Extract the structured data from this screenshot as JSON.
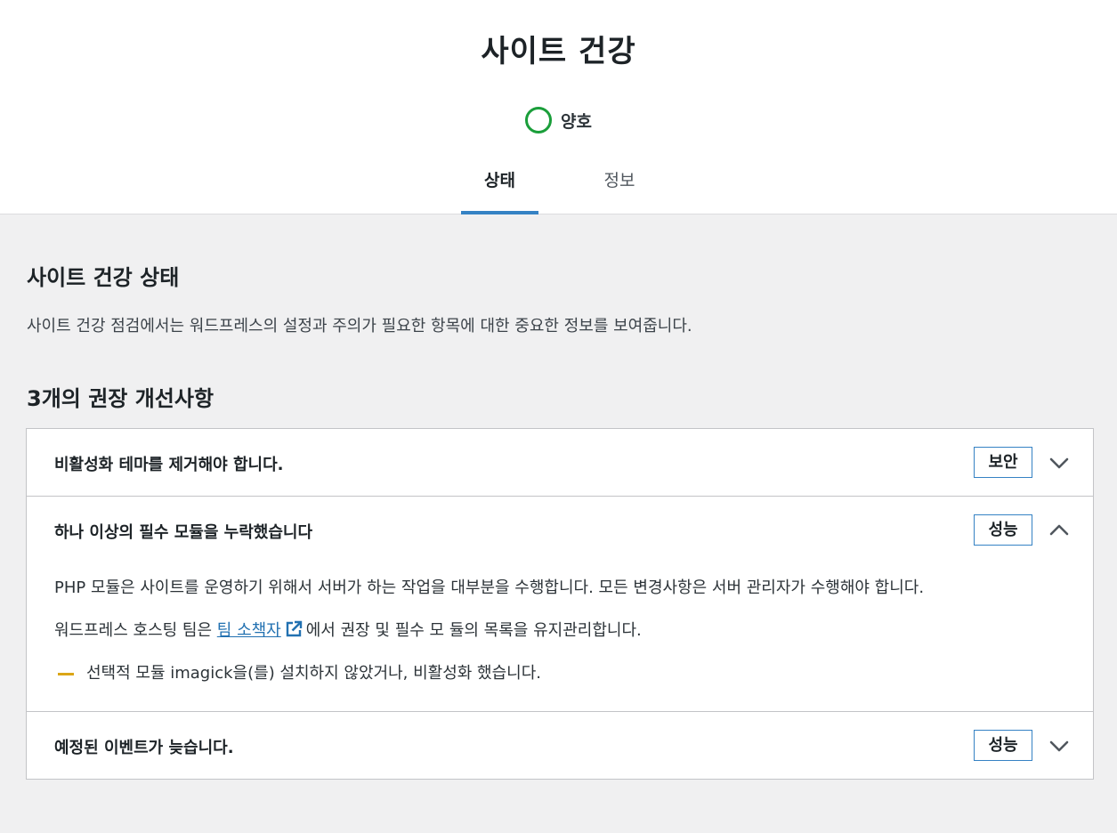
{
  "header": {
    "title": "사이트 건강",
    "status_label": "양호",
    "status_color": "#1a9e3a",
    "tabs": [
      {
        "label": "상태",
        "active": true
      },
      {
        "label": "정보",
        "active": false
      }
    ]
  },
  "main": {
    "section_title": "사이트 건강 상태",
    "section_description": "사이트 건강 점검에서는 워드프레스의 설정과 주의가 필요한 항목에 대한 중요한 정보를 보여줍니다.",
    "recommendations_count": "3개의 권장 개선사항",
    "items": [
      {
        "title": "비활성화 테마를 제거해야 합니다.",
        "badge": "보안",
        "expanded": false,
        "chevron": "chevron-down-icon"
      },
      {
        "title": "하나 이상의 필수 모듈을 누락했습니다",
        "badge": "성능",
        "expanded": true,
        "chevron": "chevron-up-icon",
        "body": {
          "para1": "PHP 모듈은 사이트를 운영하기 위해서 서버가 하는 작업을 대부분을 수행합니다. 모든 변경사항은 서버 관리자가 수행해야 합니다.",
          "para2_before": "워드프레스 호스팅 팀은",
          "para2_link": "팀 소책자",
          "para2_after": "에서 권장 및 필수 모 듈의 목록을 유지관리합니다.",
          "warning": "선택적 모듈 imagick을(를) 설치하지 않았거나, 비활성화 했습니다."
        }
      },
      {
        "title": "예정된 이벤트가 늦습니다.",
        "badge": "성능",
        "expanded": false,
        "chevron": "chevron-down-icon"
      }
    ]
  },
  "colors": {
    "accent": "#3582c4",
    "link": "#2271b1",
    "warning": "#dba617"
  }
}
